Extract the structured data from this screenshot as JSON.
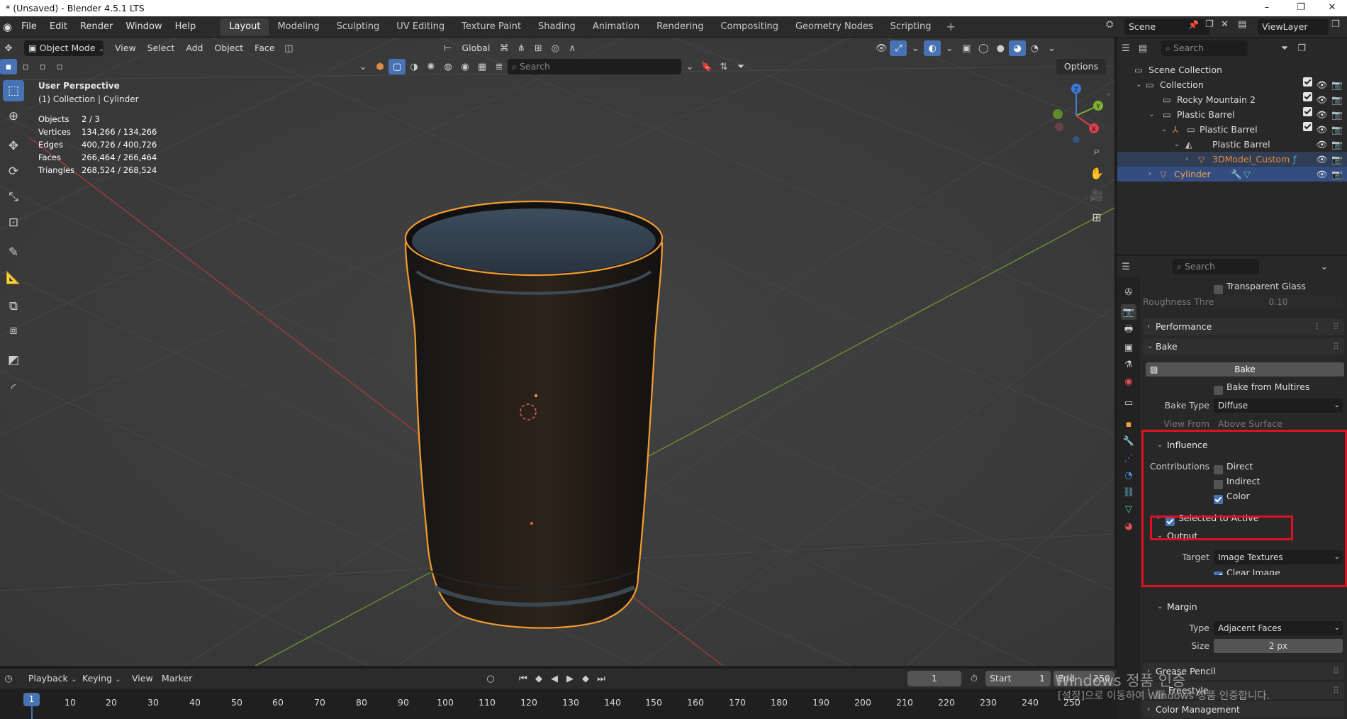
{
  "window": {
    "title": "* (Unsaved) - Blender 4.5.1 LTS",
    "min": "–",
    "max": "❐",
    "close": "✕"
  },
  "menu": [
    "File",
    "Edit",
    "Render",
    "Window",
    "Help"
  ],
  "workspaces": [
    "Layout",
    "Modeling",
    "Sculpting",
    "UV Editing",
    "Texture Paint",
    "Shading",
    "Animation",
    "Rendering",
    "Compositing",
    "Geometry Nodes",
    "Scripting"
  ],
  "active_workspace": "Layout",
  "scene": {
    "name": "Scene",
    "view_layer": "ViewLayer"
  },
  "viewport_header": {
    "mode": "Object Mode",
    "menus": [
      "View",
      "Select",
      "Add",
      "Object",
      "Face"
    ],
    "orientation": "Global",
    "search_placeholder": "Search",
    "options": "Options"
  },
  "viewport_info": {
    "perspective": "User Perspective",
    "collection": "(1) Collection | Cylinder",
    "stats": [
      {
        "label": "Objects",
        "value": "2 / 3"
      },
      {
        "label": "Vertices",
        "value": "134,266 / 134,266"
      },
      {
        "label": "Edges",
        "value": "400,726 / 400,726"
      },
      {
        "label": "Faces",
        "value": "266,464 / 266,464"
      },
      {
        "label": "Triangles",
        "value": "268,524 / 268,524"
      }
    ]
  },
  "gizmo": {
    "z": "Z",
    "y": "Y",
    "x": "X"
  },
  "outliner": {
    "search_placeholder": "Search",
    "rows": [
      {
        "label": "Scene Collection"
      },
      {
        "label": "Collection"
      },
      {
        "label": "Rocky Mountain 2"
      },
      {
        "label": "Plastic Barrel"
      },
      {
        "label": "Plastic Barrel"
      },
      {
        "label": "3DModel_Custom"
      },
      {
        "label": "Cylinder"
      }
    ]
  },
  "properties": {
    "search_placeholder": "Search",
    "transparent_glass": "Transparent Glass",
    "roughness_label": "Roughness Thre...",
    "roughness_value": "0.10",
    "performance": "Performance",
    "bake": "Bake",
    "bake_button": "Bake",
    "bake_from_multires": "Bake from Multires",
    "bake_type_label": "Bake Type",
    "bake_type_value": "Diffuse",
    "view_from_label": "View From",
    "view_from_value": "Above Surface",
    "influence": "Influence",
    "contributions_label": "Contributions",
    "direct": "Direct",
    "indirect": "Indirect",
    "color": "Color",
    "selected_to_active": "Selected to Active",
    "output": "Output",
    "target_label": "Target",
    "target_value": "Image Textures",
    "clear_image": "Clear Image",
    "margin": "Margin",
    "type_label": "Type",
    "type_value": "Adjacent Faces",
    "size_label": "Size",
    "size_value": "2 px",
    "grease_pencil": "Grease Pencil",
    "freestyle": "Freestyle",
    "color_management": "Color Management"
  },
  "timeline": {
    "menus": [
      "Playback",
      "Keying",
      "View",
      "Marker"
    ],
    "current_frame": "1",
    "start_label": "Start",
    "start_value": "1",
    "end_label": "End",
    "end_value": "250",
    "ruler_current": "1",
    "ticks": [
      "10",
      "20",
      "30",
      "40",
      "50",
      "60",
      "70",
      "80",
      "90",
      "100",
      "110",
      "120",
      "130",
      "140",
      "150",
      "160",
      "170",
      "180",
      "190",
      "200",
      "210",
      "220",
      "230",
      "240",
      "250"
    ]
  },
  "watermark": {
    "line1": "Windows 정품 인증",
    "line2": "[설정]으로 이동하여 Windows 정품 인증합니다."
  }
}
